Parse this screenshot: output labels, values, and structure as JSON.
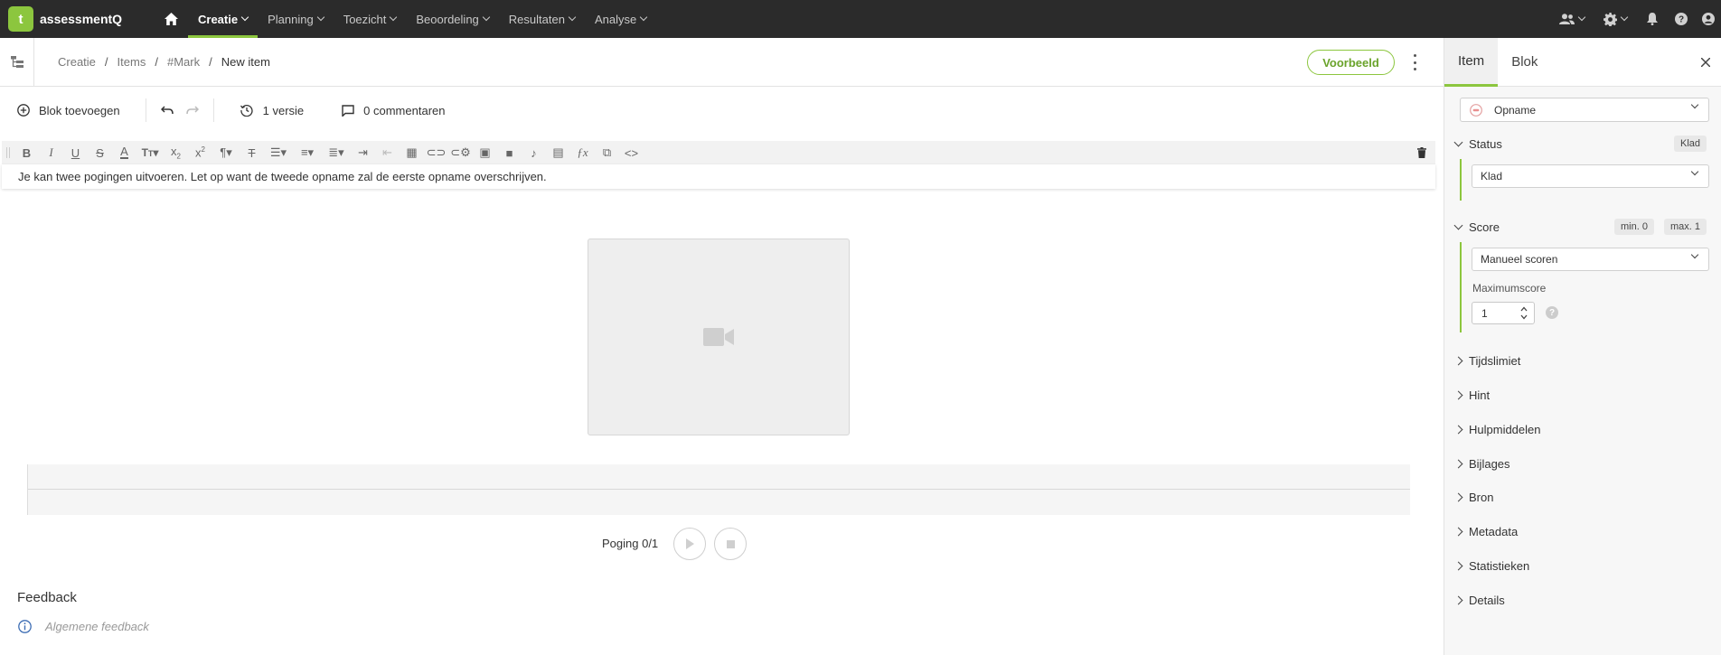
{
  "brand": {
    "name": "assessmentQ",
    "badge": "t"
  },
  "nav": {
    "items": [
      {
        "label": "Creatie",
        "active": true
      },
      {
        "label": "Planning"
      },
      {
        "label": "Toezicht"
      },
      {
        "label": "Beoordeling"
      },
      {
        "label": "Resultaten"
      },
      {
        "label": "Analyse"
      }
    ]
  },
  "breadcrumb": {
    "items": [
      "Creatie",
      "Items",
      "#Mark"
    ],
    "current": "New item",
    "separator": "/"
  },
  "header": {
    "preview_label": "Voorbeeld"
  },
  "toolbar": {
    "add_block": "Blok toevoegen",
    "versions": "1 versie",
    "comments": "0 commentaren"
  },
  "editor": {
    "text": "Je kan twee pogingen uitvoeren. Let op want de tweede opname zal de eerste opname overschrijven."
  },
  "recorder": {
    "attempts": "Poging 0/1"
  },
  "feedback": {
    "title": "Feedback",
    "placeholder": "Algemene feedback"
  },
  "panel": {
    "tabs": [
      "Item",
      "Blok"
    ],
    "active_tab": "Item",
    "type_select": "Opname",
    "status": {
      "label": "Status",
      "badge": "Klad",
      "value": "Klad"
    },
    "score": {
      "label": "Score",
      "min": "min. 0",
      "max": "max. 1",
      "mode": "Manueel scoren",
      "max_label": "Maximumscore",
      "max_value": "1",
      "help": "?"
    },
    "sections": [
      "Tijdslimiet",
      "Hint",
      "Hulpmiddelen",
      "Bijlages",
      "Bron",
      "Metadata",
      "Statistieken",
      "Details"
    ]
  },
  "colors": {
    "accent": "#8cc63e",
    "topbar": "#2b2b2b",
    "panel_bg": "#f7f7f7"
  }
}
